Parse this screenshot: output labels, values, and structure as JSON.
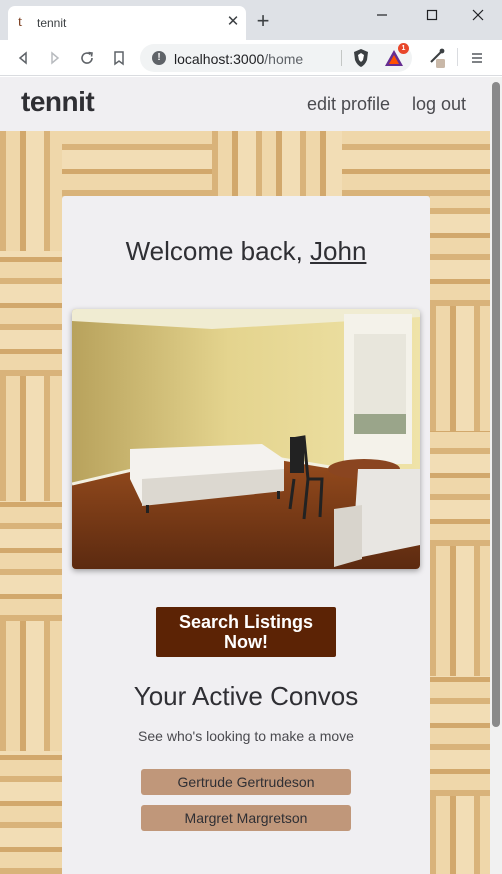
{
  "browser": {
    "tab": {
      "favicon": "t",
      "title": "tennit",
      "close_icon": "close-icon"
    },
    "new_tab_icon": "plus-icon",
    "window_controls": [
      "minimize-icon",
      "maximize-icon",
      "close-icon"
    ],
    "nav_icons": [
      "back-icon",
      "forward-icon",
      "reload-icon",
      "bookmark-icon"
    ],
    "url": {
      "host": "localhost:3000",
      "path": "/home"
    },
    "rewards_badge": "1",
    "extension_icons": [
      "brave-shield-icon",
      "bat-rewards-icon",
      "eyedropper-icon",
      "menu-icon"
    ]
  },
  "site": {
    "brand": "tennit",
    "nav": {
      "edit_profile": "edit profile",
      "log_out": "log out"
    }
  },
  "main": {
    "welcome_prefix": "Welcome back, ",
    "user_name": "John",
    "search_button": "Search Listings Now!",
    "convos_title": "Your Active Convos",
    "convos_subtitle": "See who's looking to make a move",
    "convos": [
      {
        "name": "Gertrude Gertrudeson"
      },
      {
        "name": "Margret Margretson"
      }
    ]
  },
  "colors": {
    "brand_dark": "#5c2305",
    "convo_button": "#c0977a",
    "card_bg": "#f0eff2"
  }
}
